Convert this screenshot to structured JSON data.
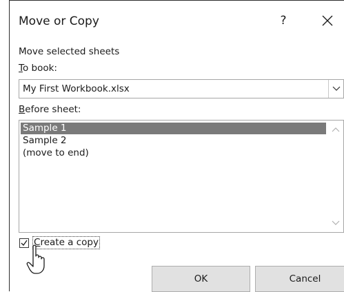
{
  "dialog": {
    "title": "Move or Copy",
    "help_glyph": "?",
    "close_icon": "close-icon"
  },
  "form": {
    "section_label": "Move selected sheets",
    "to_book_label_mnemonic": "T",
    "to_book_label_rest": "o book:",
    "to_book_value": "My First Workbook.xlsx",
    "before_sheet_label_mnemonic": "B",
    "before_sheet_label_rest": "efore sheet:",
    "sheets": [
      {
        "label": "Sample 1",
        "selected": true
      },
      {
        "label": "Sample 2",
        "selected": false
      },
      {
        "label": "(move to end)",
        "selected": false
      }
    ],
    "create_copy_checked": true,
    "create_copy_label_mnemonic": "C",
    "create_copy_label_rest": "reate a copy"
  },
  "buttons": {
    "ok": "OK",
    "cancel": "Cancel"
  },
  "colors": {
    "selection": "#7a7a7a",
    "button_face": "#e1e1e1",
    "border": "#a6a6a6"
  }
}
